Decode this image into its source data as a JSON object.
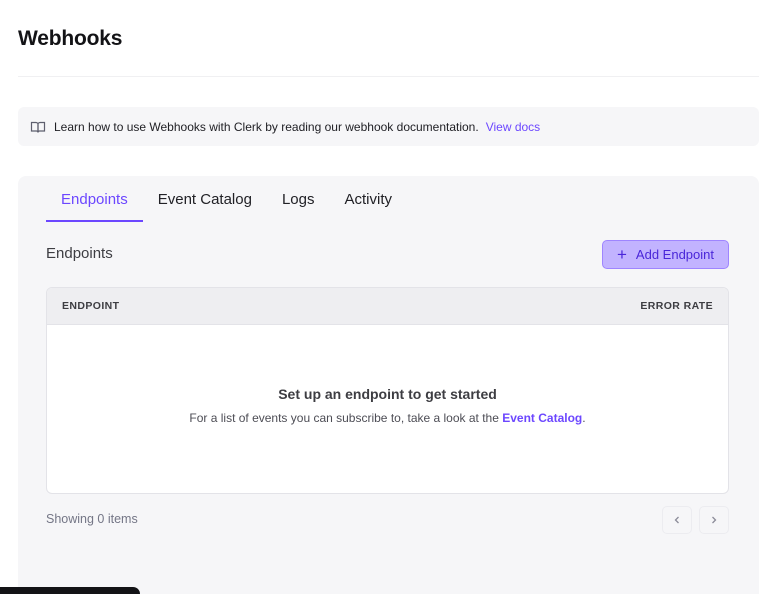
{
  "page": {
    "title": "Webhooks"
  },
  "banner": {
    "icon": "book-open-icon",
    "text": "Learn how to use Webhooks with Clerk by reading our webhook documentation.",
    "link_label": "View docs"
  },
  "tabs": [
    {
      "label": "Endpoints",
      "active": true
    },
    {
      "label": "Event Catalog",
      "active": false
    },
    {
      "label": "Logs",
      "active": false
    },
    {
      "label": "Activity",
      "active": false
    }
  ],
  "endpoints": {
    "section_title": "Endpoints",
    "add_button": {
      "icon": "plus-icon",
      "label": "Add Endpoint"
    },
    "table": {
      "columns": [
        "ENDPOINT",
        "ERROR RATE"
      ],
      "rows": []
    },
    "empty_state": {
      "title": "Set up an endpoint to get started",
      "text_before": "For a list of events you can subscribe to, take a look at the",
      "link_label": "Event Catalog",
      "text_after": "."
    },
    "footer": {
      "showing_label": "Showing 0 items",
      "prev_icon": "chevron-left-icon",
      "next_icon": "chevron-right-icon"
    }
  },
  "colors": {
    "accent": "#6c47ff",
    "button_bg": "#c2b3ff",
    "panel_bg": "#f6f6f8"
  }
}
